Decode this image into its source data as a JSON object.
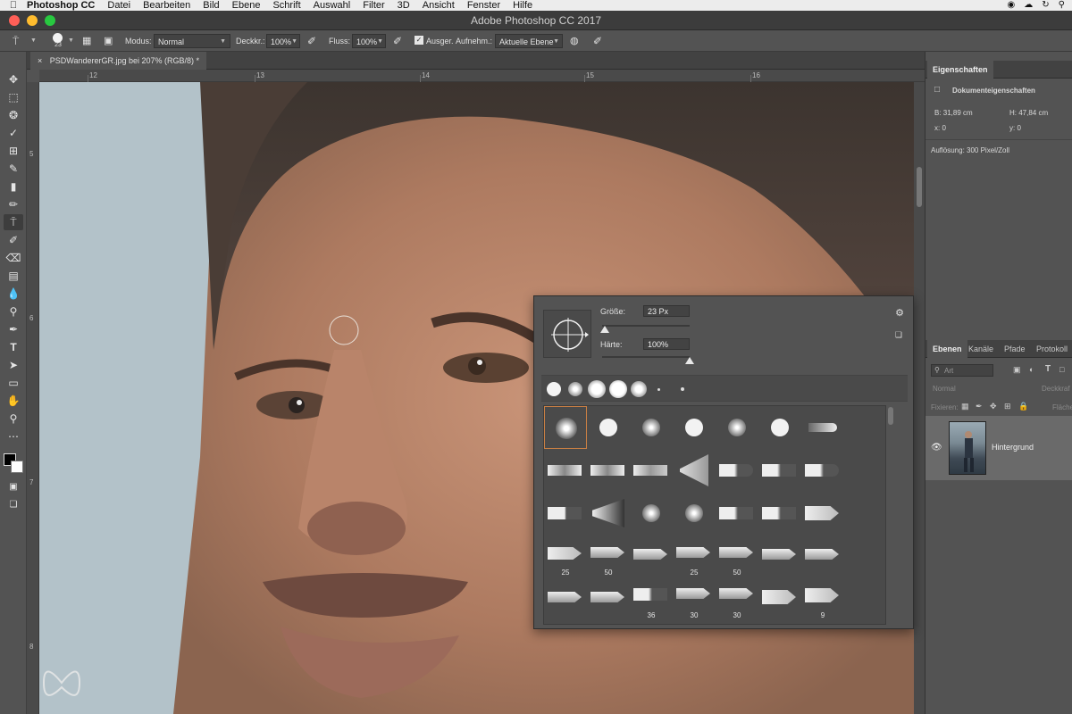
{
  "menubar": {
    "app_name": "Photoshop CC",
    "items": [
      "Datei",
      "Bearbeiten",
      "Bild",
      "Ebene",
      "Schrift",
      "Auswahl",
      "Filter",
      "3D",
      "Ansicht",
      "Fenster",
      "Hilfe"
    ]
  },
  "window": {
    "title": "Adobe Photoshop CC 2017"
  },
  "options_bar": {
    "brush_size": "23",
    "mode_label": "Modus:",
    "mode_value": "Normal",
    "opacity_label": "Deckkr.:",
    "opacity_value": "100%",
    "flow_label": "Fluss:",
    "flow_value": "100%",
    "aligned_label": "Ausger.",
    "sample_label": "Aufnehm.:",
    "sample_value": "Aktuelle Ebene"
  },
  "document": {
    "tab_title": "PSDWandererGR.jpg bei 207% (RGB/8) *"
  },
  "rulers": {
    "horizontal": [
      "12",
      "13",
      "14",
      "15",
      "16"
    ],
    "vertical": [
      "5",
      "6",
      "7",
      "8"
    ]
  },
  "brush_picker": {
    "size_label": "Größe:",
    "size_value": "23 Px",
    "size_level": 0.03,
    "hardness_label": "Härte:",
    "hardness_value": "100%",
    "hardness_level": 1.0,
    "preset_numbers": [
      "25",
      "50",
      "25",
      "50",
      "36",
      "30",
      "30",
      "9"
    ]
  },
  "properties_panel": {
    "tab": "Eigenschaften",
    "header": "Dokumenteigenschaften",
    "width": "B: 31,89 cm",
    "height": "H: 47,84 cm",
    "x": "x: 0",
    "y": "y: 0",
    "resolution": "Auflösung: 300 Pixel/Zoll"
  },
  "layers_panel": {
    "tabs": [
      "Ebenen",
      "Kanäle",
      "Pfade",
      "Protokoll"
    ],
    "search_placeholder": "Art",
    "blend_mode": "Normal",
    "opacity_label": "Deckkraf",
    "lock_label": "Fixieren:",
    "fill_label": "Fläche",
    "layer_name": "Hintergrund"
  },
  "colors": {
    "accent_selection": "#c87f44",
    "light_close": "#ff5f57",
    "light_min": "#febc2e",
    "light_max": "#28c840"
  }
}
